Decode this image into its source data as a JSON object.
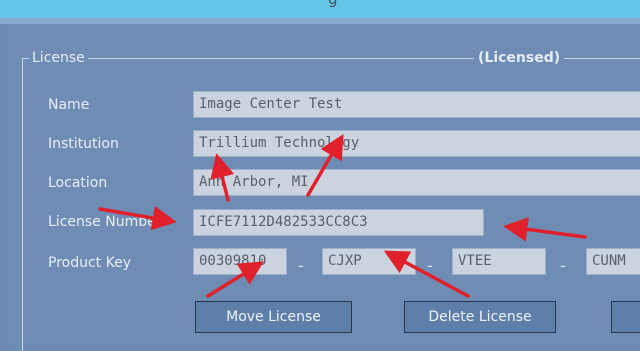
{
  "header": {
    "title_fragment": "g"
  },
  "license": {
    "legend": "License",
    "status": "(Licensed)",
    "fields": {
      "name": {
        "label": "Name",
        "value": "Image Center Test"
      },
      "institution": {
        "label": "Institution",
        "value": "Trillium Technology"
      },
      "location": {
        "label": "Location",
        "value": "Ann Arbor, MI"
      },
      "license_number": {
        "label": "License Number",
        "value": "ICFE7112D482533CC8C3"
      },
      "product_key": {
        "label": "Product Key",
        "parts": [
          "00309810",
          "CJXP",
          "VTEE",
          "CUNM"
        ]
      }
    },
    "separators": [
      "-",
      "-",
      "-"
    ],
    "buttons": {
      "move": "Move License",
      "delete": "Delete License"
    }
  },
  "colors": {
    "arrow": "#e0202a",
    "background": "#6f8db4",
    "topbar": "#63c6e6"
  }
}
